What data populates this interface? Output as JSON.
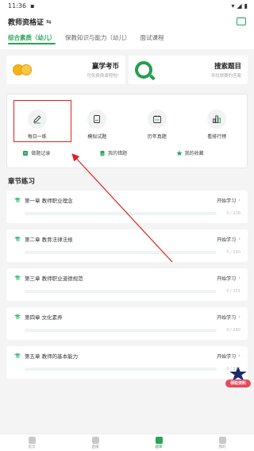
{
  "status_bar": {
    "time": "11:36"
  },
  "header": {
    "title": "教师资格证",
    "swap_symbol": "⇆"
  },
  "tabs": [
    {
      "label": "综合素质（幼儿）",
      "active": true
    },
    {
      "label": "保教知识与能力（幼儿）",
      "active": false
    },
    {
      "label": "面试课程",
      "active": false
    }
  ],
  "promos": [
    {
      "title": "赢学考币",
      "subtitle": "可免费换课程啦!"
    },
    {
      "title": "搜索题目",
      "subtitle": "寻找想要的答案"
    }
  ],
  "tools": [
    {
      "label": "每日一练",
      "icon": "pencil-icon"
    },
    {
      "label": "模拟试题",
      "icon": "document-icon"
    },
    {
      "label": "历年真题",
      "icon": "calendar-icon"
    },
    {
      "label": "看排行榜",
      "icon": "bar-chart-icon"
    }
  ],
  "tools_row2": [
    {
      "label": "做题记录",
      "icon": "record-icon"
    },
    {
      "label": "我的错题",
      "icon": "wrong-icon"
    },
    {
      "label": "我的收藏",
      "icon": "star-icon"
    }
  ],
  "section_title": "章节练习",
  "chapters": [
    {
      "name": "第一章  教师职业理念",
      "action": "开始学习",
      "count": "0 / 138",
      "progress": 0
    },
    {
      "name": "第二章  教育法律法规",
      "action": "开始学习",
      "count": "0 / 140",
      "progress": 0
    },
    {
      "name": "第三章  教师职业道德规范",
      "action": "开始学习",
      "count": "0 / 151",
      "progress": 0
    },
    {
      "name": "第四章  文化素养",
      "action": "开始学习",
      "count": "0 / 280",
      "progress": 0
    },
    {
      "name": "第五章  教师的基本能力",
      "action": "开始学习",
      "count": "0 / 141",
      "progress": 0
    }
  ],
  "float_badge": "领取资料",
  "bottom_nav": [
    {
      "label": "首页",
      "active": false
    },
    {
      "label": "直播",
      "active": false
    },
    {
      "label": "题库",
      "active": true
    },
    {
      "label": "我的",
      "active": false
    }
  ],
  "colors": {
    "accent": "#2aa35b",
    "highlight": "#e02020"
  }
}
